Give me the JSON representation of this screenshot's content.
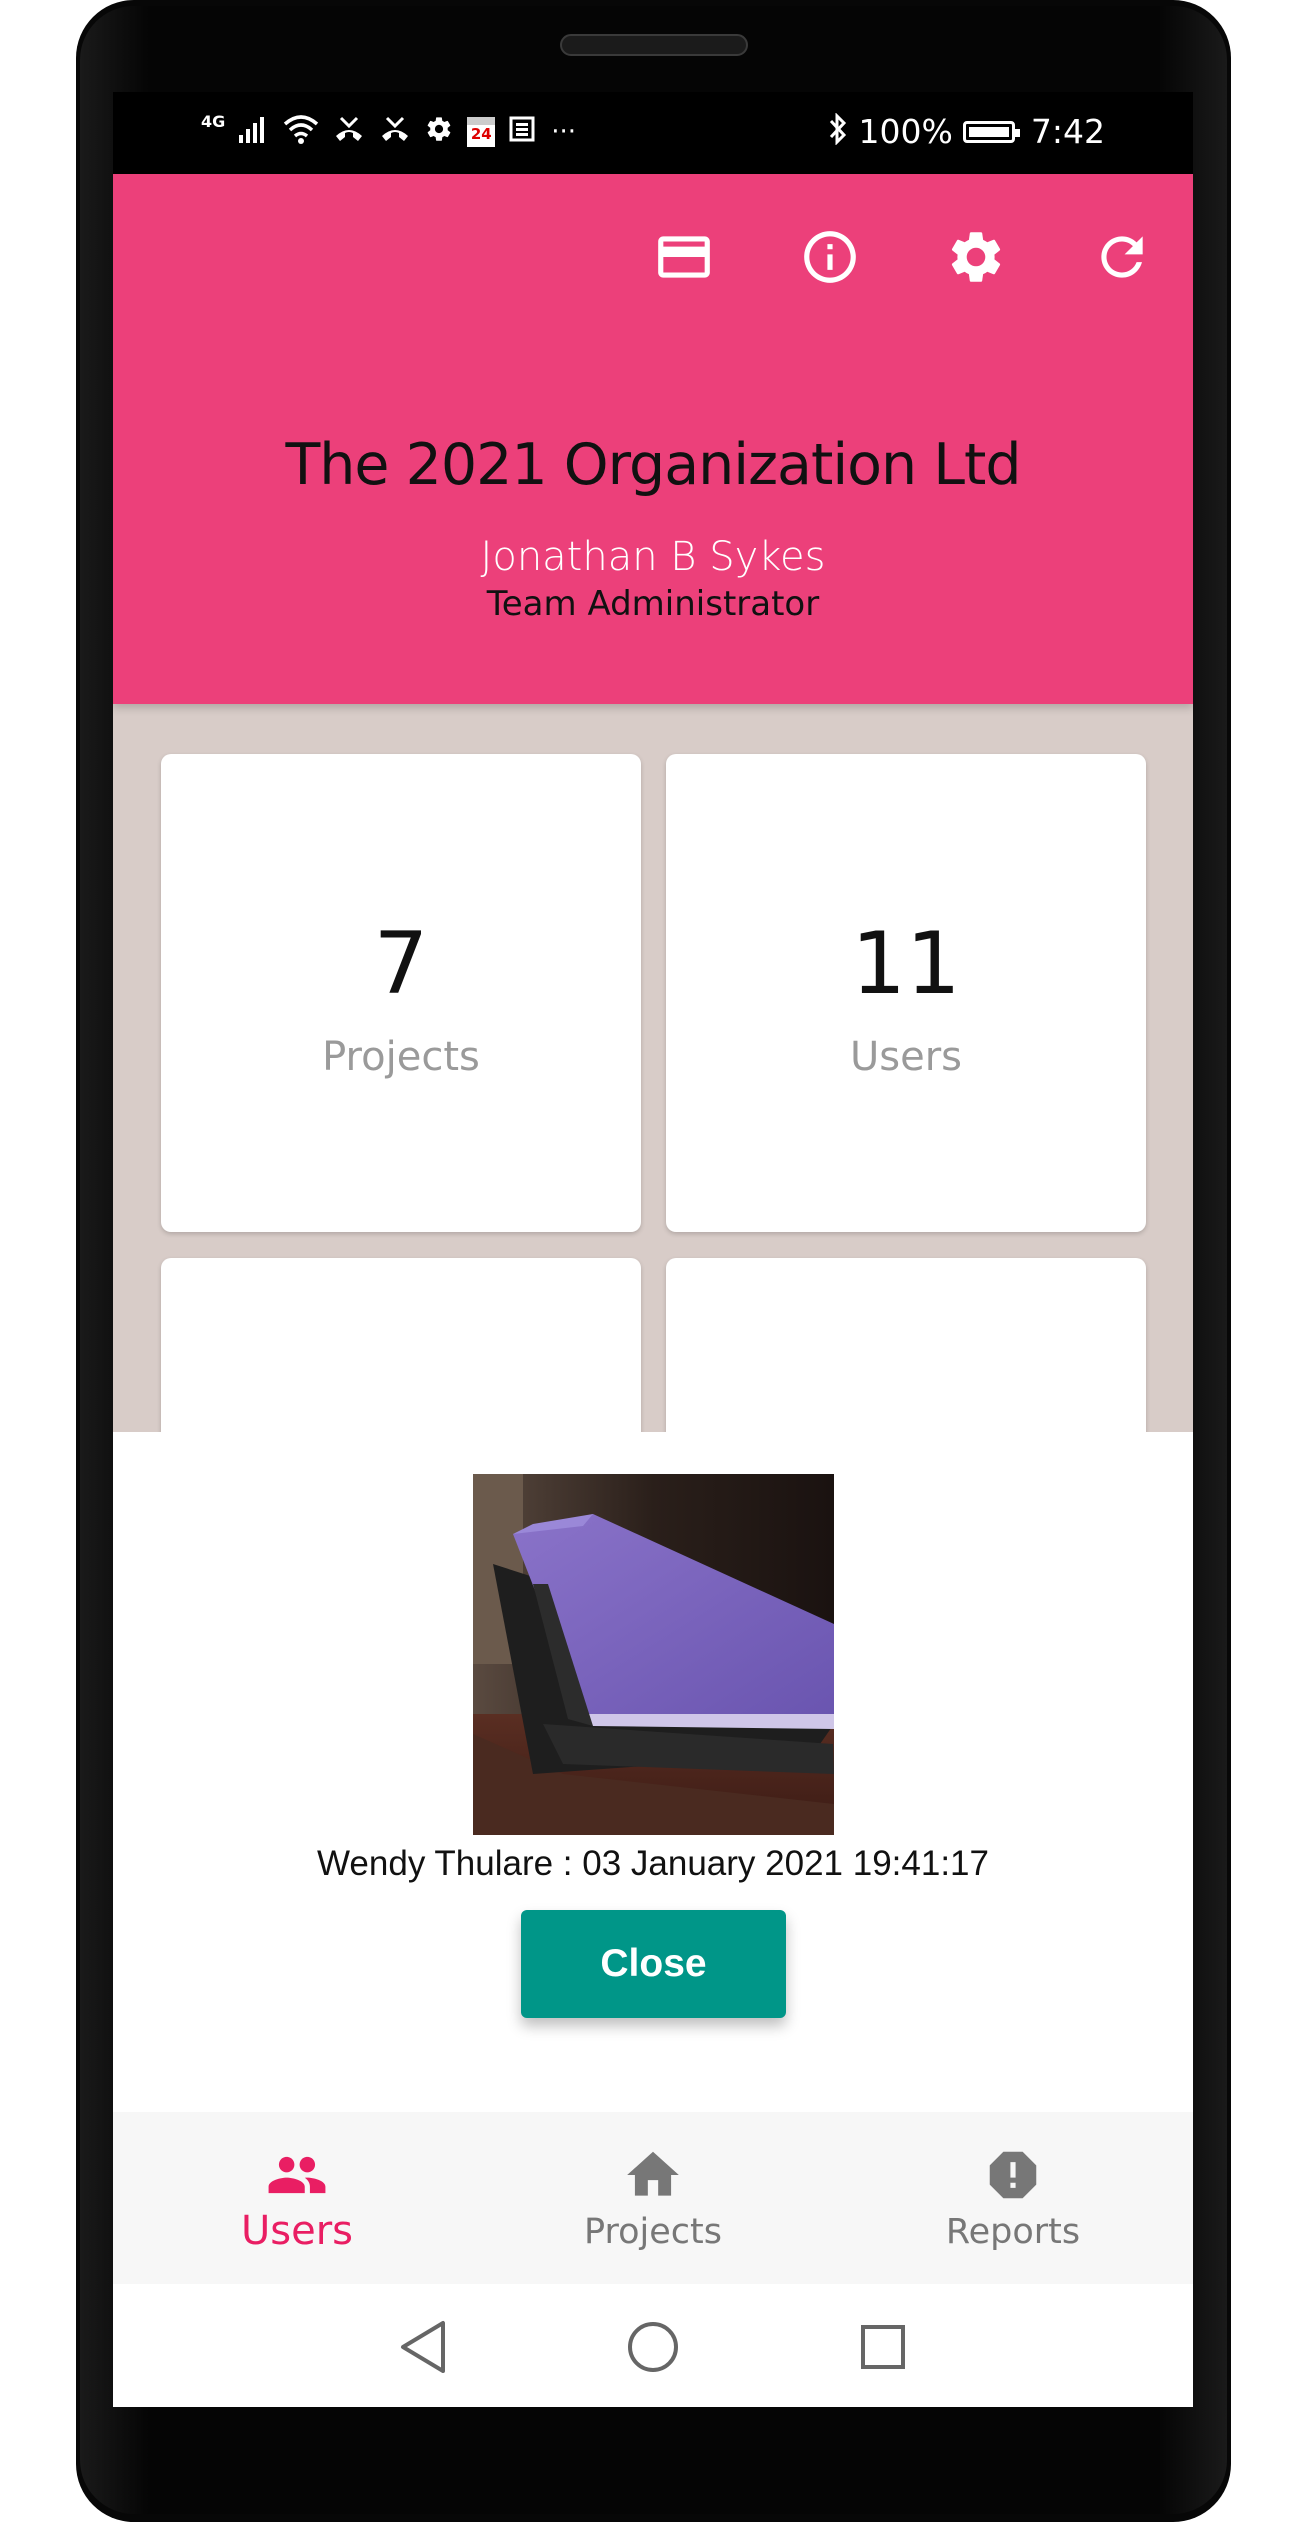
{
  "status_bar": {
    "network": "4G",
    "battery_percent": "100%",
    "time": "7:42",
    "calendar_day": "24",
    "more": "···"
  },
  "header": {
    "org_name": "The 2021 Organization Ltd",
    "user_name": "Jonathan B Sykes",
    "user_role": "Team Administrator",
    "accent_color": "#EC407A",
    "actions": [
      {
        "name": "card-icon"
      },
      {
        "name": "info-icon"
      },
      {
        "name": "settings-icon"
      },
      {
        "name": "refresh-icon"
      }
    ]
  },
  "dashboard": {
    "cards": [
      {
        "value": "7",
        "label": "Projects"
      },
      {
        "value": "11",
        "label": "Users"
      }
    ]
  },
  "photo_sheet": {
    "caption": "Wendy Thulare : 03 January 2021 19:41:17",
    "close_label": "Close",
    "button_color": "#009688"
  },
  "bottom_nav": {
    "items": [
      {
        "label": "Users",
        "icon": "users-icon",
        "active": true
      },
      {
        "label": "Projects",
        "icon": "home-icon",
        "active": false
      },
      {
        "label": "Reports",
        "icon": "alert-icon",
        "active": false
      }
    ],
    "active_color": "#E91E63"
  },
  "system_nav": {
    "buttons": [
      "back-icon",
      "home-circle-icon",
      "recents-icon"
    ]
  }
}
